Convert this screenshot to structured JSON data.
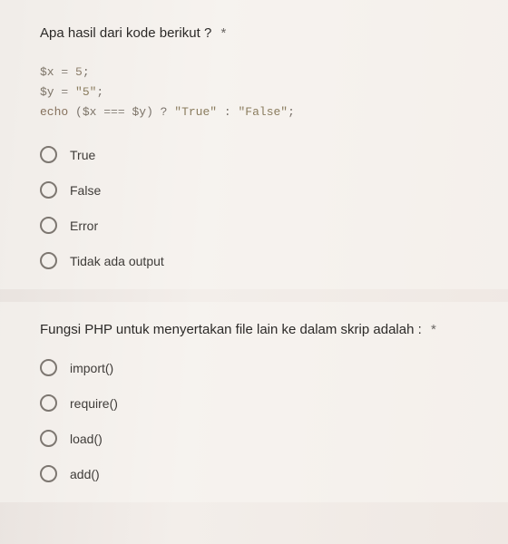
{
  "q1": {
    "title": "Apa hasil dari kode berikut ?",
    "required_mark": "*",
    "code": {
      "l1_var": "$x",
      "l1_op": " = ",
      "l1_val": "5",
      "l1_end": ";",
      "l2_var": "$y",
      "l2_op": " = ",
      "l2_val": "\"5\"",
      "l2_end": ";",
      "l3_kw": "echo",
      "l3_open": " (",
      "l3_a": "$x",
      "l3_cmp": " === ",
      "l3_b": "$y",
      "l3_close": ") ? ",
      "l3_t": "\"True\"",
      "l3_mid": " : ",
      "l3_f": "\"False\"",
      "l3_end": ";"
    },
    "options": [
      "True",
      "False",
      "Error",
      "Tidak ada output"
    ]
  },
  "q2": {
    "title": "Fungsi PHP untuk menyertakan file lain ke dalam skrip adalah :",
    "required_mark": "*",
    "options": [
      "import()",
      "require()",
      "load()",
      "add()"
    ]
  }
}
